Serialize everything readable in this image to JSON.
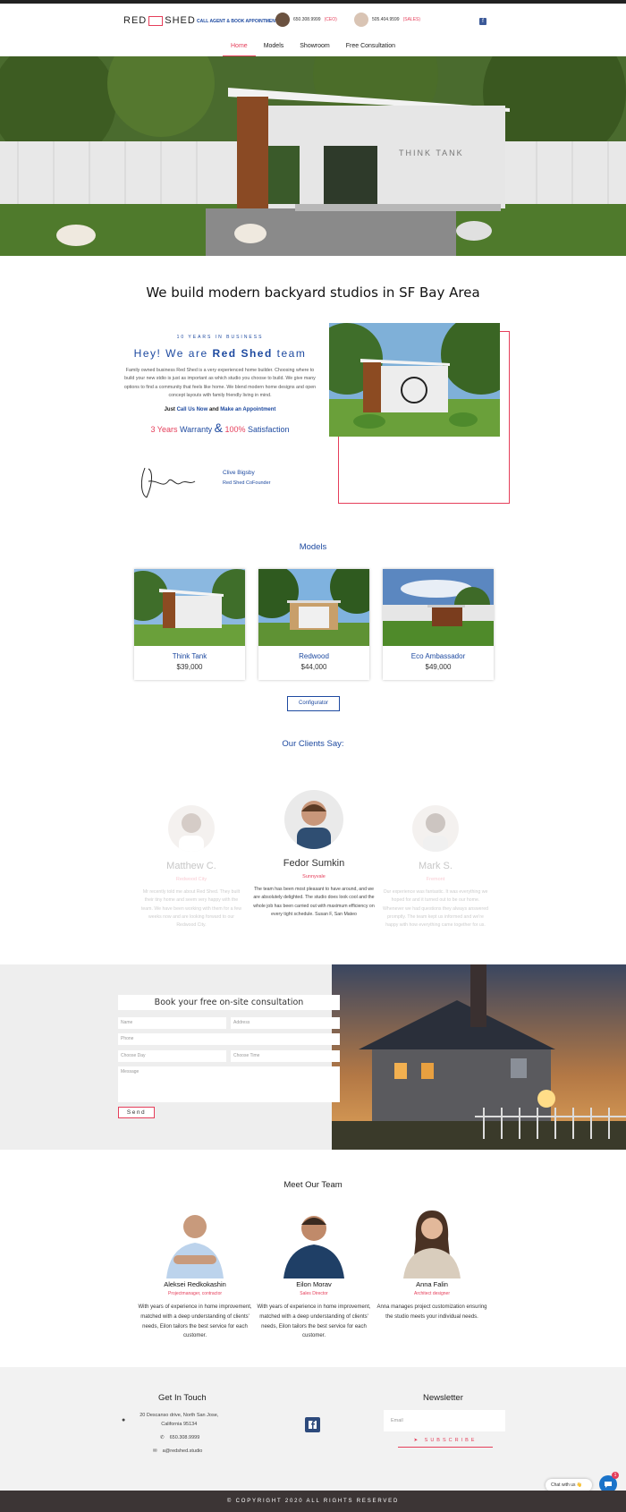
{
  "header": {
    "logo_left": "RED",
    "logo_right": "SHED",
    "agent_cta": "CALL AGENT & BOOK APPOINTMENT",
    "contacts": [
      {
        "phone": "650.308.9999",
        "tag": "(CEO)"
      },
      {
        "phone": "505.404.9599",
        "tag": "(SALES)"
      }
    ],
    "facebook_glyph": "f"
  },
  "nav": {
    "items": [
      "Home",
      "Models",
      "Showroom",
      "Free Consultation"
    ],
    "active": "Home"
  },
  "hero": {
    "building_label": "THINK TANK"
  },
  "intro": {
    "headline": "We build modern backyard studios in SF Bay Area"
  },
  "about": {
    "kicker": "10 YEARS IN BUSINESS",
    "greeting": "Hey! We are ",
    "brand": "Red Shed",
    "greeting_end": " team",
    "paragraph": "Family owned business Red Shed is a very experienced home builder. Choosing where to build your new stdio is just as important as which studio you choose to build. We give many options to find a community that feels like home. We blend modern home designs and open concept layouts with family friendly living in mind.",
    "cta_just": "Just ",
    "cta_call": "Call Us Now",
    "cta_and": " and ",
    "cta_appt": "Make an Appointment",
    "w_years": "3 Years",
    "w_warranty": " Warranty ",
    "w_amp": "&",
    "w_pct": " 100%",
    "w_satisfaction": " Satisfaction",
    "signer_name": "Clive Bigsby",
    "signer_role": "Red Shed CoFounder"
  },
  "models": {
    "title": "Models",
    "items": [
      {
        "name": "Think Tank",
        "price": "$39,000"
      },
      {
        "name": "Redwood",
        "price": "$44,000"
      },
      {
        "name": "Eco Ambassador",
        "price": "$49,000"
      }
    ],
    "configurator_label": "Configurator"
  },
  "clients": {
    "title": "Our Clients Say:",
    "items": [
      {
        "name": "Matthew C.",
        "location": "Redwood City",
        "text": "Mr recently told me about Red Shed. They built their tiny home and seem very happy with the team. We have been working with them for a few weeks now and are looking forward to our Redwood City."
      },
      {
        "name": "Fedor Sumkin",
        "location": "Sunnyvale",
        "text": "The team has been most pleasant to have around, and we are absolutely delighted. The studio does look cool and the whole job has been carried out with maximum efficiency on every tight schedule. Susan F, San Mateo"
      },
      {
        "name": "Mark S.",
        "location": "Fremont",
        "text": "Our experience was fantastic. It was everything we hoped for and it turned out to be our home. Whenever we had questions they always answered promptly. The team kept us informed and we're happy with how everything came together for us."
      }
    ]
  },
  "booking": {
    "title": "Book your free on-site consultation",
    "name_ph": "Name",
    "address_ph": "Address",
    "phone_ph": "Phone",
    "day_ph": "Choose Day",
    "time_ph": "Choose Time",
    "message_ph": "Message",
    "send_label": "Send"
  },
  "team": {
    "title": "Meet Our Team",
    "members": [
      {
        "name": "Aleksei Redkokashin",
        "role": "Projectmanager, contractor",
        "bio": "With years of experience in home improvement, matched with a deep understanding of clients' needs, Eilon tailors the best service for each customer."
      },
      {
        "name": "Eilon Morav",
        "role": "Sales Director",
        "bio": "With years of experience in home improvement, matched with a deep understanding of clients' needs, Eilon tailors the best service for each customer."
      },
      {
        "name": "Anna Falin",
        "role": "Architect designer",
        "bio": "Anna manages project customization ensuring the studio meets your individual needs."
      }
    ]
  },
  "footer": {
    "get_in_touch": "Get In Touch",
    "address_line1": "20 Descanso drive, North San Jose,",
    "address_line2": "California 95134",
    "phone": "650.308.9999",
    "email": "a@redshed.studio",
    "newsletter": "Newsletter",
    "email_ph": "Email",
    "subscribe": "SUBSCRIBE",
    "copyright": "© COPYRIGHT 2020 ALL RIGHTS RESERVED"
  },
  "chat": {
    "label": "Chat with us 👋",
    "badge": "1"
  },
  "colors": {
    "accent_red": "#e53e5a",
    "brand_blue": "#1e4aa0",
    "footer_dark": "#3c3535"
  }
}
